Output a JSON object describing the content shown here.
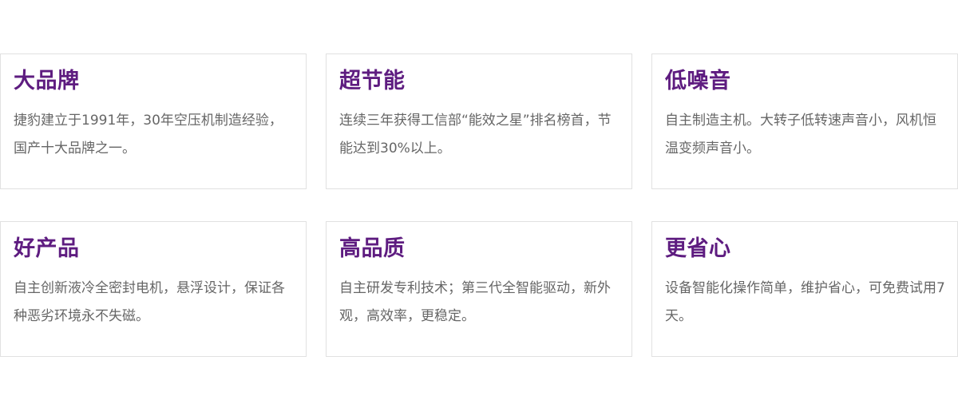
{
  "colors": {
    "accent": "#5e1c80",
    "text": "#666666",
    "border": "#e1e1e1"
  },
  "features": [
    {
      "title": "大品牌",
      "description": "捷豹建立于1991年，30年空压机制造经验，国产十大品牌之一。"
    },
    {
      "title": "超节能",
      "description": "连续三年获得工信部“能效之星”排名榜首，节能达到30%以上。"
    },
    {
      "title": "低噪音",
      "description": "自主制造主机。大转子低转速声音小，风机恒温变频声音小。"
    },
    {
      "title": "好产品",
      "description": "自主创新液冷全密封电机，悬浮设计，保证各种恶劣环境永不失磁。"
    },
    {
      "title": "高品质",
      "description": "自主研发专利技术；第三代全智能驱动，新外观，高效率，更稳定。"
    },
    {
      "title": "更省心",
      "description": "设备智能化操作简单，维护省心，可免费试用7天。"
    }
  ]
}
